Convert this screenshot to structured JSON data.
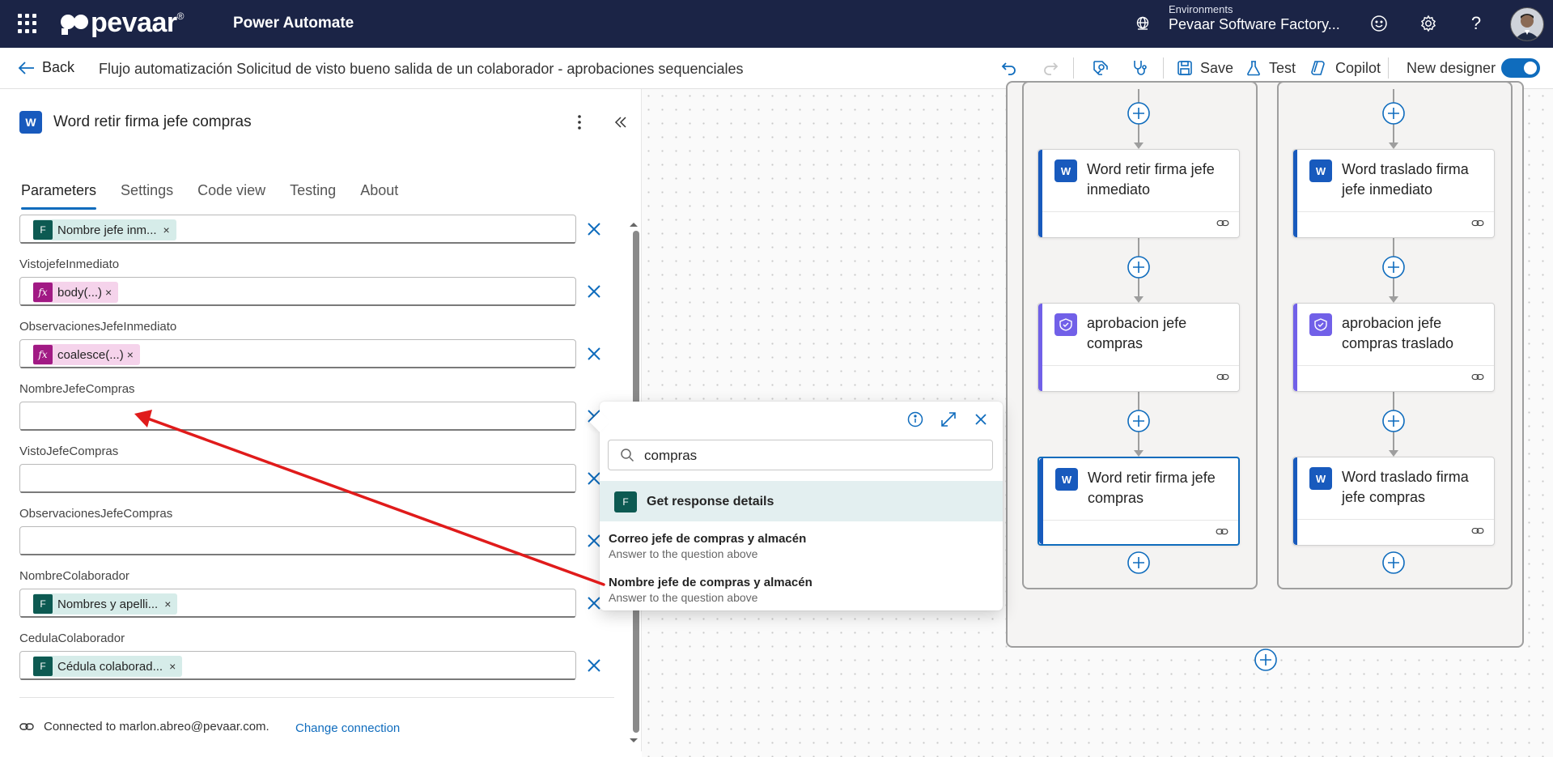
{
  "topbar": {
    "brand": "pevaar",
    "brand_mark": "®",
    "product": "Power Automate",
    "env_label": "Environments",
    "env_name": "Pevaar Software Factory...",
    "icons": [
      "app-launcher-icon",
      "environment-globe-icon",
      "feedback-smiley-icon",
      "settings-gear-icon",
      "help-question-icon",
      "user-avatar"
    ]
  },
  "cmdbar": {
    "back_label": "Back",
    "flow_title": "Flujo automatización Solicitud de visto bueno salida de un colaborador - aprobaciones sequenciales",
    "save_label": "Save",
    "test_label": "Test",
    "copilot_label": "Copilot",
    "new_designer_label": "New designer",
    "new_designer_on": true
  },
  "panel": {
    "title": "Word retir firma jefe compras",
    "tabs": [
      {
        "label": "Parameters",
        "active": true
      },
      {
        "label": "Settings",
        "active": false
      },
      {
        "label": "Code view",
        "active": false
      },
      {
        "label": "Testing",
        "active": false
      },
      {
        "label": "About",
        "active": false
      }
    ],
    "fields": [
      {
        "label": "",
        "token": "Nombre jefe inm...",
        "token_type": "forms"
      },
      {
        "label": "VistojefeInmediato",
        "token": "body(...)",
        "token_type": "fx"
      },
      {
        "label": "ObservacionesJefeInmediato",
        "token": "coalesce(...)",
        "token_type": "fx"
      },
      {
        "label": "NombreJefeCompras",
        "token": "",
        "token_type": ""
      },
      {
        "label": "VistoJefeCompras",
        "token": "",
        "token_type": ""
      },
      {
        "label": "ObservacionesJefeCompras",
        "token": "",
        "token_type": ""
      },
      {
        "label": "NombreColaborador",
        "token": "Nombres y apelli...",
        "token_type": "forms"
      },
      {
        "label": "CedulaColaborador",
        "token": "Cédula colaborad...",
        "token_type": "forms"
      }
    ],
    "token_remove": "×",
    "connection_text": "Connected to marlon.abreo@pevaar.com.",
    "change_connection": "Change connection"
  },
  "dynamic_content": {
    "search_value": "compras",
    "group_title": "Get response details",
    "options": [
      {
        "title": "Correo jefe de compras y almacén",
        "subtitle": "Answer to the question above"
      },
      {
        "title": "Nombre jefe de compras y almacén",
        "subtitle": "Answer to the question above"
      }
    ]
  },
  "canvas": {
    "left_branch": [
      {
        "title": "Word retir firma jefe inmediato",
        "kind": "word"
      },
      {
        "title": "aprobacion jefe compras",
        "kind": "approval"
      },
      {
        "title": "Word retir firma jefe compras",
        "kind": "word",
        "selected": true
      }
    ],
    "right_branch": [
      {
        "title": "Word traslado firma jefe inmediato",
        "kind": "word"
      },
      {
        "title": "aprobacion jefe compras traslado",
        "kind": "approval"
      },
      {
        "title": "Word traslado firma jefe compras",
        "kind": "word"
      }
    ]
  },
  "colors": {
    "topbar": "#1b2446",
    "accent": "#0f6cbd",
    "word": "#185abd",
    "approval": "#7160e8",
    "forms_token": "#0d5a52",
    "fx_token": "#a11a84",
    "annotation_arrow": "#e01b1b"
  }
}
